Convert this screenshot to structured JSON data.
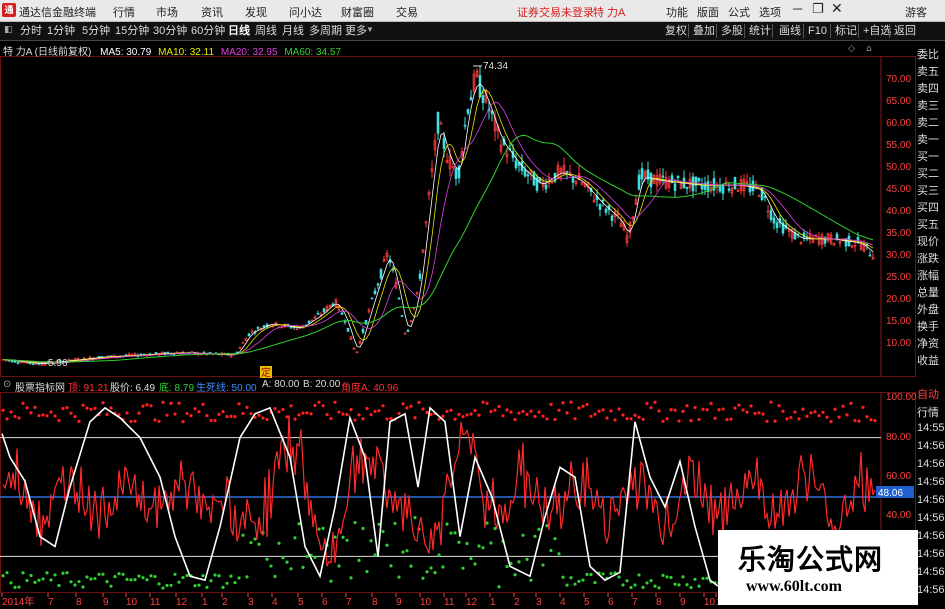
{
  "app": {
    "title": "通达信金融终端",
    "login_notice": "证券交易未登录",
    "stock": "特 力A",
    "guest": "游客"
  },
  "menu": [
    "行情",
    "市场",
    "资讯",
    "发现",
    "问小达",
    "财富圈",
    "交易"
  ],
  "menu_right": [
    "功能",
    "版面",
    "公式",
    "选项"
  ],
  "toolbar": {
    "periods": [
      "分时",
      "1分钟",
      "5分钟",
      "15分钟",
      "30分钟",
      "60分钟",
      "日线",
      "周线",
      "月线",
      "多周期",
      "更多"
    ],
    "active_period": "日线",
    "right": [
      "复权",
      "叠加",
      "多股",
      "统计",
      "画线",
      "F10",
      "标记",
      "+自选",
      "返回"
    ]
  },
  "legend": {
    "name": "特 力A (日线前复权)",
    "items": [
      {
        "label": "MA5: 30.79",
        "color": "#ffffff"
      },
      {
        "label": "MA10: 32.11",
        "color": "#e8e800"
      },
      {
        "label": "MA20: 32.95",
        "color": "#e040e0"
      },
      {
        "label": "MA60: 34.57",
        "color": "#30d030"
      }
    ]
  },
  "price_axis": [
    "70.00",
    "65.00",
    "60.00",
    "55.00",
    "50.00",
    "45.00",
    "40.00",
    "35.00",
    "30.00",
    "25.00",
    "20.00",
    "15.00",
    "10.00"
  ],
  "annotations": {
    "high": "74.34",
    "low": "5.96",
    "mark": "定"
  },
  "indicator": {
    "name": "股票指标网",
    "items": [
      {
        "label": "顶: 91.21",
        "color": "#ff3030"
      },
      {
        "label": "股价: 6.49",
        "color": "#dddddd"
      },
      {
        "label": "底: 8.79",
        "color": "#30d030"
      },
      {
        "label": "生死线: 50.00",
        "color": "#4090ff"
      },
      {
        "label": "A: 80.00",
        "color": "#dddddd"
      },
      {
        "label": "B: 20.00",
        "color": "#dddddd"
      },
      {
        "label": "角度A: 40.96",
        "color": "#ff3030"
      }
    ],
    "axis": [
      "100.00",
      "80.00",
      "60.00",
      "48.06",
      "40.00"
    ],
    "current": "48.06"
  },
  "x_axis": [
    "2014年",
    "7",
    "8",
    "9",
    "10",
    "11",
    "12",
    "1",
    "2",
    "3",
    "4",
    "5",
    "6",
    "7",
    "8",
    "9",
    "10",
    "11",
    "12",
    "1",
    "2",
    "3",
    "4",
    "5",
    "6",
    "7",
    "8",
    "9",
    "10",
    "1"
  ],
  "right_panel": {
    "top": [
      "委比",
      "卖五",
      "卖四",
      "卖三",
      "卖二",
      "卖一",
      "买一",
      "买二",
      "买三",
      "买四",
      "买五",
      "现价",
      "涨跌",
      "涨幅",
      "总量",
      "外盘",
      "换手",
      "净资",
      "收益"
    ],
    "bottom": [
      "自动",
      "行情",
      "14:55",
      "14:56",
      "14:56",
      "14:56",
      "14:56",
      "14:56",
      "14:56",
      "14:56",
      "14:56",
      "14:56"
    ]
  },
  "watermark": {
    "title": "乐淘公式网",
    "url": "www.60lt.com"
  },
  "chart_data": {
    "type": "line",
    "title": "特 力A (日线前复权)",
    "ylim": [
      5,
      75
    ],
    "series": [
      {
        "name": "MA60",
        "values": [
          6.5,
          7.0,
          8.2,
          9.0,
          10.5,
          13.0,
          15.5,
          19.0,
          28.0,
          40.0,
          52.0,
          56.0,
          54.0,
          50.0,
          48.0,
          46.0,
          45.0,
          41.0,
          37.0,
          35.0
        ]
      }
    ],
    "price_high": 74.34,
    "price_low": 5.96
  }
}
